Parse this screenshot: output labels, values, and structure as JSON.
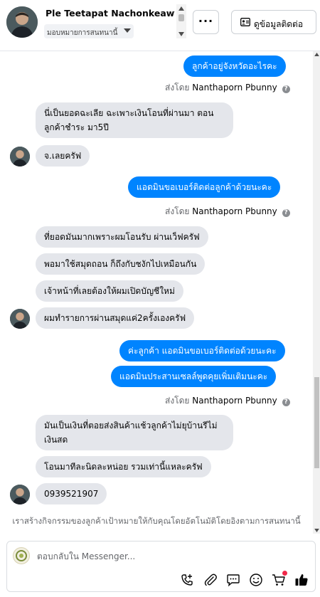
{
  "header": {
    "contact_name": "Ple Teetapat Nachonkeawyo",
    "assign_label": "มอบหมายการสนทนานี้",
    "more_label": "···",
    "details_label": "ดูข้อมูลติดต่อ"
  },
  "messages": [
    {
      "type": "out",
      "text": "ลูกค้าอยู่จังหวัดอะไรคะ"
    },
    {
      "type": "sent_by",
      "prefix": "ส่งโดย",
      "name": "Nanthaporn Pbunny",
      "info": "?"
    },
    {
      "type": "in",
      "text": "นี่เป็นยอดฉะเลีย ฉะเพาะเงินโอนที่ผ่านมา ตอนลูกค้าชำระ มา5ปี"
    },
    {
      "type": "in",
      "text": "จ.เลยครัฟ"
    },
    {
      "type": "out",
      "text": "แอดมินขอเบอร์ติดต่อลูกค้าด้วยนะคะ"
    },
    {
      "type": "sent_by",
      "prefix": "ส่งโดย",
      "name": "Nanthaporn Pbunny",
      "info": "?"
    },
    {
      "type": "in",
      "text": "ที่ยอดมันมากเพราะผมโอนรับ ผ่านเว็ฟครัฟ"
    },
    {
      "type": "in",
      "text": "พอมาใช้สมุดถอน ก็ถึงกับชงักไปเหมือนกัน"
    },
    {
      "type": "in",
      "text": "เจ้าหน้าที่เลยต้องให้ผมเปิดบัญชีใหม่"
    },
    {
      "type": "in",
      "text": "ผมทำรายการผ่านสมุดแค่2ครั้งเองครัฟ"
    },
    {
      "type": "out",
      "text": "ค่ะลูกค้า แอดมินขอเบอร์ติดต่อด้วยนะคะ"
    },
    {
      "type": "out",
      "text": "แอดมินประสานเซลล์พูดคุยเพิ่มเติมนะคะ"
    },
    {
      "type": "sent_by",
      "prefix": "ส่งโดย",
      "name": "Nanthaporn Pbunny",
      "info": "?"
    },
    {
      "type": "in",
      "text": "มันเป็นเงินที่ตอยส่งสินค้าแช้วลูกค้าไม่ยุบ้านรีไม่เงินสด"
    },
    {
      "type": "in",
      "text": "โอนมาทีละนิดละหน่อย รวมเท่านี้แหละครัฟ"
    },
    {
      "type": "in",
      "text": "0939521907"
    }
  ],
  "notice": "เราสร้างกิจกรรมของลูกค้าเป้าหมายให้กับคุณโดยอัตโนมัติโดยอิงตามการสนทนานี้",
  "composer": {
    "placeholder": "ตอบกลับใน Messenger..."
  },
  "colors": {
    "outgoing_bubble": "#0084ff",
    "incoming_bubble": "#e4e6eb",
    "notification_dot": "#f02849",
    "link_blue": "#1877f2"
  },
  "icons": [
    "chevron-down-icon",
    "contact-card-icon",
    "phone-plus-icon",
    "paperclip-icon",
    "chat-bubble-icon",
    "emoji-icon",
    "cart-icon",
    "thumbs-up-icon",
    "info-icon"
  ]
}
